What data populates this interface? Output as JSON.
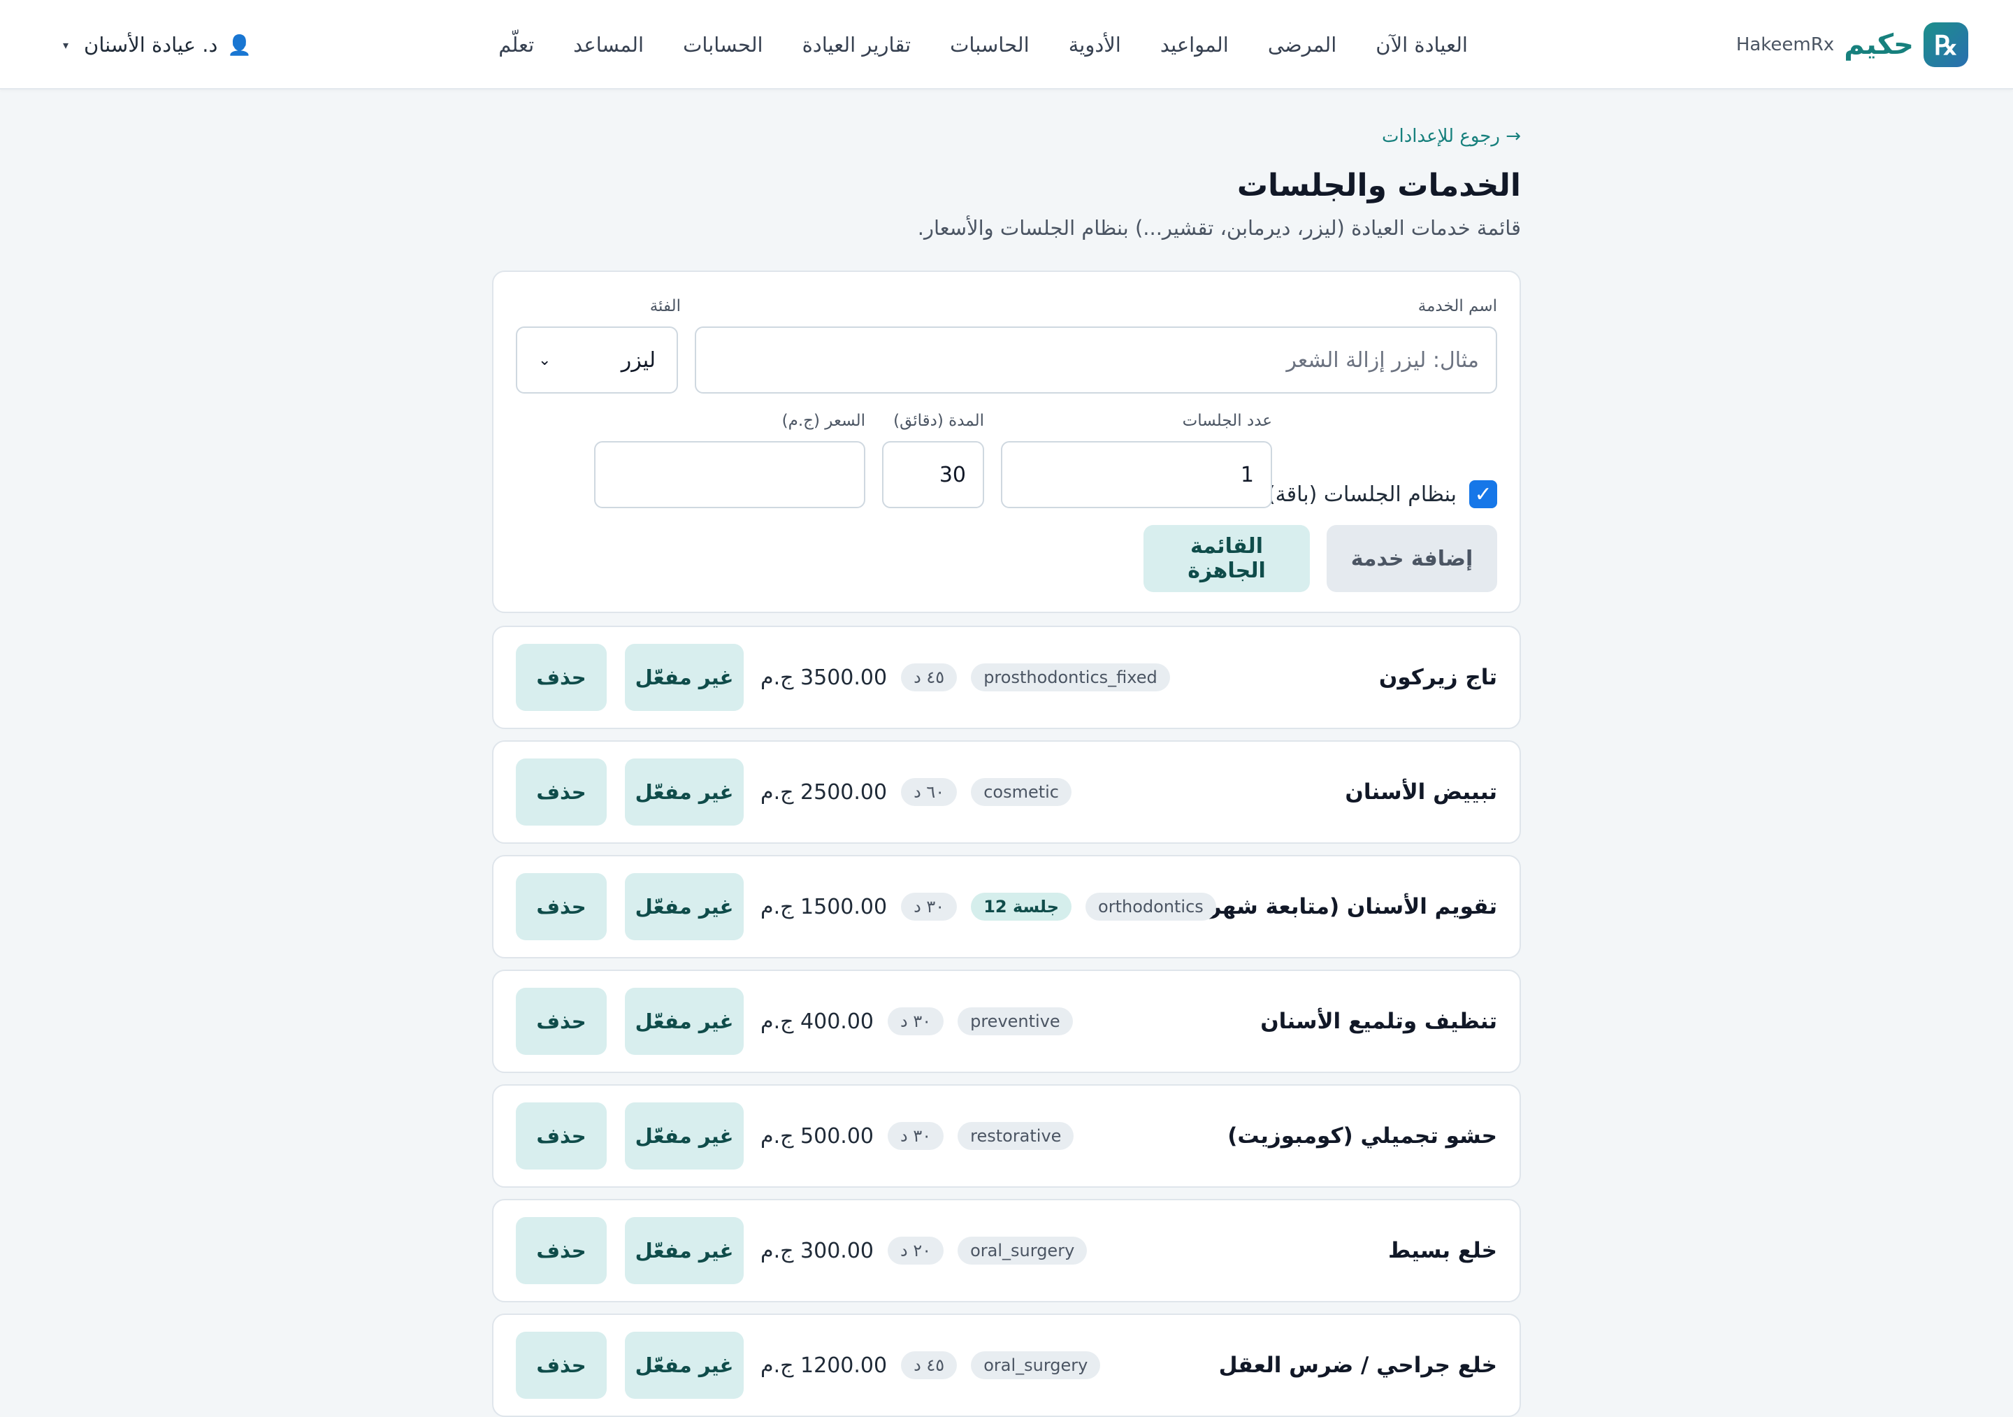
{
  "brand": {
    "name_ar": "حكيم",
    "name_en": "HakeemRx",
    "logo_glyph": "℞"
  },
  "nav": {
    "items": [
      "العيادة الآن",
      "المرضى",
      "المواعيد",
      "الأدوية",
      "الحاسبات",
      "تقارير العيادة",
      "الحسابات",
      "المساعد",
      "تعلّم"
    ]
  },
  "user": {
    "name": "د. عيادة الأسنان",
    "icon": "user-icon",
    "caret": "▾"
  },
  "page": {
    "back_link": "→ رجوع للإعدادات",
    "title": "الخدمات والجلسات",
    "subtitle": "قائمة خدمات العيادة (ليزر، ديرمابن، تقشير...) بنظام الجلسات والأسعار."
  },
  "form": {
    "service_name_label": "اسم الخدمة",
    "service_name_placeholder": "مثال: ليزر إزالة الشعر",
    "category_label": "الفئة",
    "category_value": "ليزر",
    "sessions_label": "عدد الجلسات",
    "sessions_value": "1",
    "duration_label": "المدة (دقائق)",
    "duration_value": "30",
    "price_label": "السعر (ج.م)",
    "price_value": "",
    "package_checkbox_label": "بنظام الجلسات (باقة)",
    "package_checked": true,
    "add_button": "إضافة خدمة",
    "ready_list_button": "القائمة الجاهزة"
  },
  "services": [
    {
      "name": "تاج زيركون",
      "category": "prosthodontics_fixed",
      "duration": "٤٥ د",
      "sessions": null,
      "price": "3500.00 ج.م",
      "toggle_label": "غير مفعّل",
      "delete_label": "حذف"
    },
    {
      "name": "تبييض الأسنان",
      "category": "cosmetic",
      "duration": "٦٠ د",
      "sessions": null,
      "price": "2500.00 ج.م",
      "toggle_label": "غير مفعّل",
      "delete_label": "حذف"
    },
    {
      "name": "تقويم الأسنان (متابعة شهرية)",
      "category": "orthodontics",
      "duration": "٣٠ د",
      "sessions": "12 جلسة",
      "price": "1500.00 ج.م",
      "toggle_label": "غير مفعّل",
      "delete_label": "حذف"
    },
    {
      "name": "تنظيف وتلميع الأسنان",
      "category": "preventive",
      "duration": "٣٠ د",
      "sessions": null,
      "price": "400.00 ج.م",
      "toggle_label": "غير مفعّل",
      "delete_label": "حذف"
    },
    {
      "name": "حشو تجميلي (كومبوزيت)",
      "category": "restorative",
      "duration": "٣٠ د",
      "sessions": null,
      "price": "500.00 ج.م",
      "toggle_label": "غير مفعّل",
      "delete_label": "حذف"
    },
    {
      "name": "خلع بسيط",
      "category": "oral_surgery",
      "duration": "٢٠ د",
      "sessions": null,
      "price": "300.00 ج.م",
      "toggle_label": "غير مفعّل",
      "delete_label": "حذف"
    },
    {
      "name": "خلع جراحي / ضرس العقل",
      "category": "oral_surgery",
      "duration": "٤٥ د",
      "sessions": null,
      "price": "1200.00 ج.م",
      "toggle_label": "غير مفعّل",
      "delete_label": "حذف"
    }
  ],
  "colors": {
    "accent": "#17807d",
    "button_bg": "#d8eeee",
    "page_bg": "#f3f6f8",
    "checkbox": "#1677e8"
  }
}
